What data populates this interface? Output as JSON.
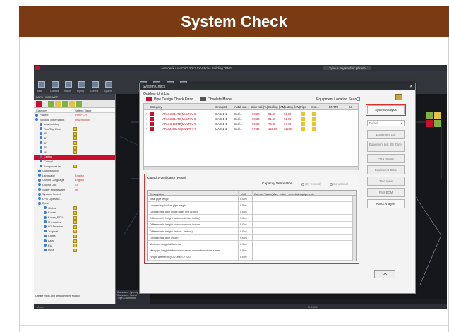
{
  "banner": {
    "title": "System Check"
  },
  "cad": {
    "title_center": "Autodesk AutoCAD 2017  LYV Fcha Building.DWG",
    "title_search": "Type a keyword or phrase",
    "ribbon_labels": [
      "Base",
      "Outdoor",
      "Indoor",
      "Piping",
      "Control",
      "System",
      "Check",
      "Share",
      "Ventilation",
      "Data"
    ],
    "left_header": "LATS HVAC MEP",
    "prop_columns": [
      "Category",
      "Setting Value"
    ],
    "tree": [
      {
        "label": "Project",
        "value": "LYV FCH",
        "kind": "item"
      },
      {
        "label": "Building Information",
        "value": "new building",
        "kind": "item"
      },
      {
        "label": "new building",
        "value": "1",
        "kind": "item"
      },
      {
        "label": "RoofTop Floor",
        "value": "",
        "kind": "check"
      },
      {
        "label": "5F",
        "value": "",
        "kind": "check"
      },
      {
        "label": "4F",
        "value": "",
        "kind": "check"
      },
      {
        "label": "3F",
        "value": "",
        "kind": "check"
      },
      {
        "label": "2F",
        "value": "",
        "kind": "check"
      },
      {
        "label": "1F",
        "value": "",
        "kind": "check"
      },
      {
        "label": "Ceiling",
        "value": "",
        "kind": "selected"
      },
      {
        "label": "Control",
        "value": "",
        "kind": "item"
      },
      {
        "label": "Equipment list",
        "value": "",
        "kind": "check"
      },
      {
        "label": "Configuration",
        "value": "",
        "kind": "item"
      },
      {
        "label": "Language",
        "value": "English",
        "kind": "item"
      },
      {
        "label": "Output Language",
        "value": "English",
        "kind": "item"
      },
      {
        "label": "Output Unit",
        "value": "SI",
        "kind": "item"
      },
      {
        "label": "Super Middleware",
        "value": "Off",
        "kind": "item"
      },
      {
        "label": "System Search",
        "value": "",
        "kind": "item"
      },
      {
        "label": "LPG Operatio...",
        "value": "",
        "kind": "item"
      },
      {
        "label": "Zone",
        "value": "",
        "kind": "item"
      },
      {
        "label": "Global",
        "value": "",
        "kind": "check"
      },
      {
        "label": "Korea",
        "value": "",
        "kind": "check"
      },
      {
        "label": "Korea_EDU",
        "value": "",
        "kind": "check"
      },
      {
        "label": "N.America",
        "value": "",
        "kind": "check"
      },
      {
        "label": "LG America",
        "value": "",
        "kind": "check"
      },
      {
        "label": "Tropical",
        "value": "",
        "kind": "check"
      },
      {
        "label": "China",
        "value": "",
        "kind": "check"
      },
      {
        "label": "Asia",
        "value": "",
        "kind": "check"
      },
      {
        "label": "EU",
        "value": "",
        "kind": "check"
      },
      {
        "label": "India",
        "value": "",
        "kind": "check"
      }
    ],
    "left_footer": "Create multi-unit arrangement(Model)",
    "cmd_text": [
      "Command: Specify",
      "Command: Select",
      "Type a command"
    ],
    "status_left": "Model",
    "status_right": "MODEL"
  },
  "dialog": {
    "title": "System Check",
    "outdoor_unit_list": "Outdoor Unit List",
    "legend_error": "Pipe Design Check Error",
    "legend_obsolete": "Obsolete Model",
    "equip_search": "Equipment Location Search",
    "columns": [
      "Category",
      "Group ID",
      "Install Lo...",
      "ation rati (%)",
      "Cooling (kW)",
      "Heating (kW)",
      "Pipe",
      "Syst...",
      "ENTRI",
      "U"
    ],
    "units": [
      {
        "category": "ARUN0211TE(MULTI V 5",
        "group": "OAC-1-1",
        "install": "Cool...",
        "ratio": "98.28",
        "cooling": "61.60",
        "heating": "61.60",
        "entri": "-"
      },
      {
        "category": "ARUN0211TE(MULTI V 5",
        "group": "OAC-1-1",
        "install": "Cool...",
        "ratio": "98.38",
        "cooling": "61.60",
        "heating": "61.60",
        "entri": "-"
      },
      {
        "category": "ARUN0168TE(MULTI V 5",
        "group": "OAC-1-1",
        "install": "Cool...",
        "ratio": "95.60",
        "cooling": "73.80",
        "heating": "67.19",
        "entri": "-"
      },
      {
        "category": "ARUM400L7S(MULTI V 5",
        "group": "UAC-1-1",
        "install": "Cool...",
        "ratio": "97.30",
        "cooling": "112.00",
        "heating": "112.00",
        "entri": "-"
      }
    ],
    "buttons": {
      "system_analysis": "System Analysis",
      "default_select": "Default",
      "equipment_list": "Equipment List",
      "equipment_list_by_zone": "Equipment List (By Zone)",
      "print_report": "Print Report",
      "equipment_table": "Equipment Table",
      "tree_view": "Tree View",
      "print_bom": "Print BOM",
      "about_analysis": "About Analysis",
      "ok": "OK"
    },
    "capacity": {
      "section_title": "Capacity Verification Result",
      "verification_label": "Capacity Verification",
      "radio_by_ground": "(By Ground)",
      "radio_conditional": "Conditional",
      "table_columns": [
        "Description",
        "Unit",
        "Current Value(Max. value : selected equipment)"
      ],
      "rows": [
        {
          "desc": "Total pipe length",
          "unit": "0.0 m"
        },
        {
          "desc": "Longest equivalent pipe length",
          "unit": "0.0 m"
        },
        {
          "desc": "Longest real pipe length after first branch",
          "unit": "0.0 m"
        },
        {
          "desc": "Difference in height (outdoor below indoor)",
          "unit": "0.0 m"
        },
        {
          "desc": "Difference in height (outdoor above indoor)",
          "unit": "0.0 m"
        },
        {
          "desc": "Difference in height (indoor - indoor)",
          "unit": "0.0 m"
        },
        {
          "desc": "Longest real pipe length",
          "unit": "0.0 m"
        },
        {
          "desc": "Minimum height difference",
          "unit": "0.0 m"
        },
        {
          "desc": "Max pipe height difference in same connection of the same",
          "unit": "0.0 m"
        },
        {
          "desc": "Height difference(IDU unit <-> IDU)",
          "unit": "0.0 m"
        }
      ]
    }
  },
  "colors": {
    "banner": "#7a3a13",
    "highlight": "#d9312e",
    "tree_selected": "#c8102e",
    "status_yellow": "#e8c62c"
  }
}
